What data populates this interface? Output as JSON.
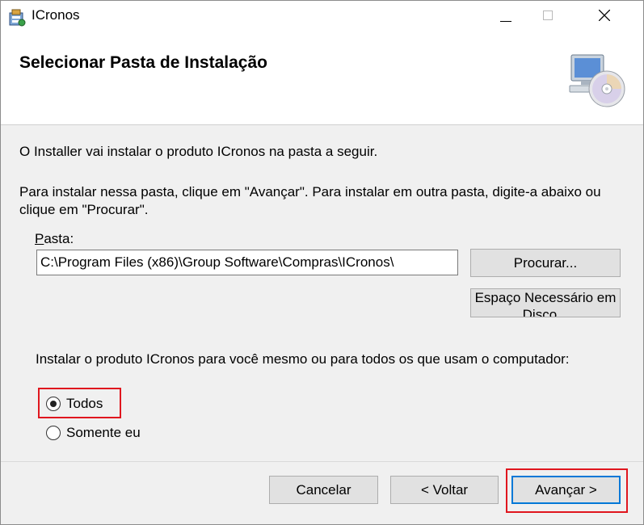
{
  "window": {
    "title": "ICronos"
  },
  "header": {
    "heading": "Selecionar Pasta de Instalação"
  },
  "body": {
    "intro": "O Installer vai instalar o produto ICronos na pasta a seguir.",
    "instructions": "Para instalar nessa pasta, clique em \"Avançar\". Para instalar em outra pasta, digite-a abaixo ou clique em \"Procurar\".",
    "folder_label_accel": "P",
    "folder_label_rest": "asta:",
    "folder_path": "C:\\Program Files (x86)\\Group Software\\Compras\\ICronos\\",
    "browse_label": "Procurar...",
    "disk_cost_label": "Espaço Necessário em Disco...",
    "install_scope_prompt": "Instalar o produto ICronos para você mesmo ou para todos os que usam o computador:",
    "options": [
      {
        "label": "Todos",
        "selected": true
      },
      {
        "label": "Somente eu",
        "selected": false
      }
    ]
  },
  "footer": {
    "cancel_label": "Cancelar",
    "back_label": "< Voltar",
    "next_label": "Avançar >"
  },
  "colors": {
    "highlight": "#e0161e",
    "default_button_border": "#0078d7"
  },
  "icons": {
    "app": "installer-package-icon",
    "header": "computer-cd-icon"
  }
}
